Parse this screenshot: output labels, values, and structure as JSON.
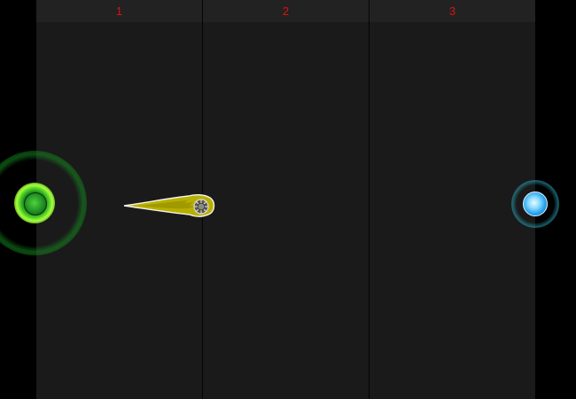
{
  "lanes": [
    {
      "label": "1"
    },
    {
      "label": "2"
    },
    {
      "label": "3"
    }
  ],
  "icons": {
    "player_orb": "green-energy-orb-icon",
    "target_orb": "blue-energy-orb-icon",
    "comet": "yellow-comet-icon"
  },
  "colors": {
    "lane_label": "#dd1111",
    "lane_background": "#1a1a1a",
    "header_background": "#222222",
    "player_glow": "#55d62a",
    "target_glow": "#2aa3ee",
    "comet_body": "#b8b000"
  }
}
